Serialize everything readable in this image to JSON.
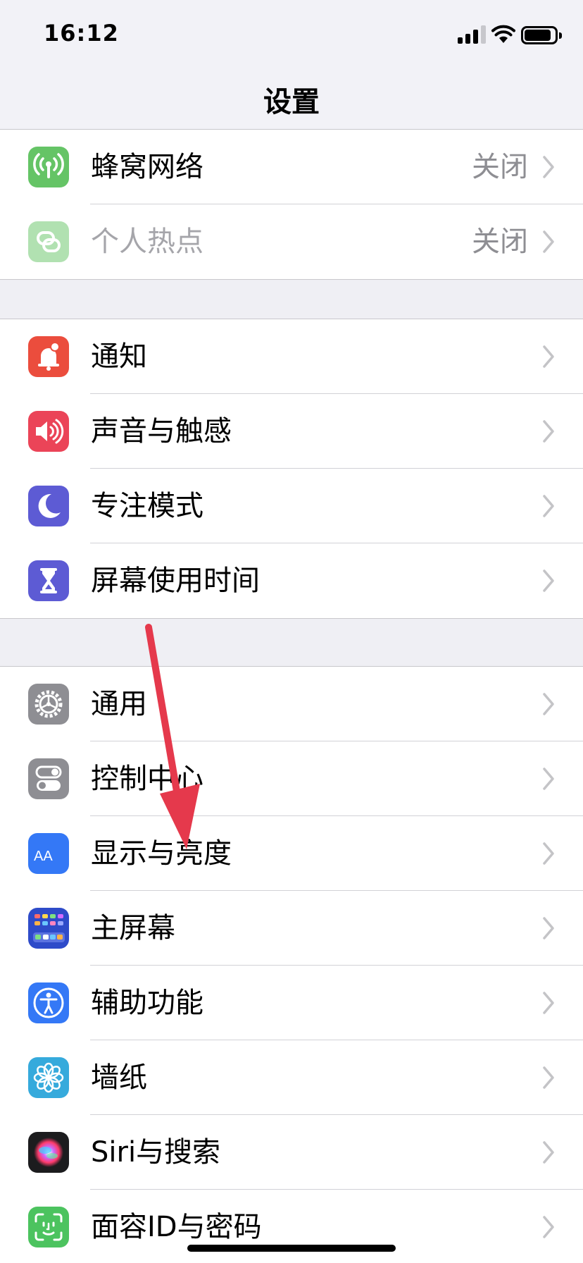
{
  "status_bar": {
    "time": "16:12",
    "signal_icon": "cellular-signal-icon",
    "wifi_icon": "wifi-icon",
    "battery_icon": "battery-icon"
  },
  "nav": {
    "title": "设置"
  },
  "groups": [
    {
      "items": [
        {
          "label": "蜂窝网络",
          "value": "关闭",
          "icon": "antenna-icon",
          "color": "#65c466",
          "enabled": true
        },
        {
          "label": "个人热点",
          "value": "关闭",
          "icon": "hotspot-link-icon",
          "color": "#65c466",
          "enabled": false
        }
      ]
    },
    {
      "items": [
        {
          "label": "通知",
          "icon": "notification-bell-icon",
          "color": "#eb4d3d"
        },
        {
          "label": "声音与触感",
          "icon": "speaker-icon",
          "color": "#eb4458"
        },
        {
          "label": "专注模式",
          "icon": "moon-icon",
          "color": "#5d5bd4"
        },
        {
          "label": "屏幕使用时间",
          "icon": "hourglass-icon",
          "color": "#5d5bd4"
        }
      ]
    },
    {
      "items": [
        {
          "label": "通用",
          "icon": "gear-icon",
          "color": "#8e8e93"
        },
        {
          "label": "控制中心",
          "icon": "toggles-icon",
          "color": "#8e8e93"
        },
        {
          "label": "显示与亮度",
          "icon": "text-size-aa-icon",
          "color": "#3478f6",
          "icon_text": "AA"
        },
        {
          "label": "主屏幕",
          "icon": "home-grid-icon",
          "color": "#2e4bc9"
        },
        {
          "label": "辅助功能",
          "icon": "accessibility-icon",
          "color": "#3478f6"
        },
        {
          "label": "墙纸",
          "icon": "flower-icon",
          "color": "#36aadc"
        },
        {
          "label": "Siri与搜索",
          "icon": "siri-icon",
          "color": "#1c1c1e"
        },
        {
          "label": "面容ID与密码",
          "icon": "face-id-icon",
          "color": "#4cc35f"
        }
      ]
    }
  ],
  "annotation": {
    "arrow_color": "#e5394c"
  }
}
